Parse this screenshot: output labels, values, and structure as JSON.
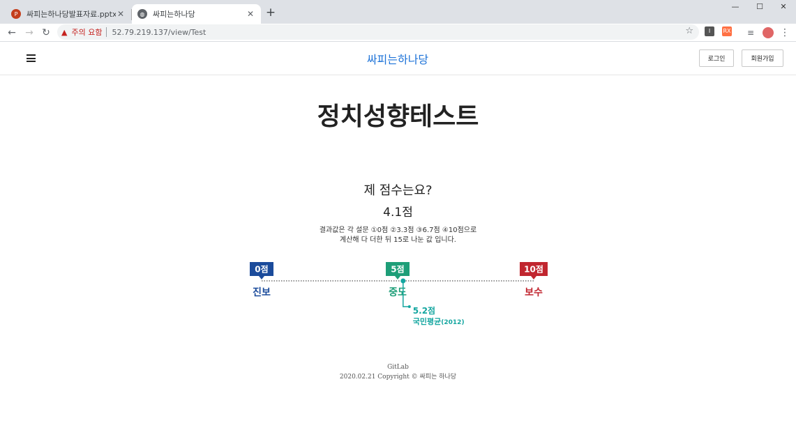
{
  "browser": {
    "tabs": [
      {
        "title": "싸피는하나당발표자료.pptx - Mi",
        "icon": "powerpoint-icon",
        "active": false
      },
      {
        "title": "싸피는하나당",
        "icon": "globe-icon",
        "active": true
      }
    ],
    "security_warning": "주의 요함",
    "url": "52.79.219.137/view/Test",
    "ext_1": "I",
    "ext_2": "RX"
  },
  "site": {
    "brand": "싸피는하나당",
    "login_label": "로그인",
    "signup_label": "회원가입"
  },
  "test": {
    "title": "정치성향테스트",
    "question": "제 점수는요?",
    "score": "4.1점",
    "explain_line1": "결과값은 각 설문 ①0점 ②3.3점 ③6.7점 ④10점으로",
    "explain_line2": "계산해 다 더한 뒤 15로 나눈 값 입니다."
  },
  "scale": {
    "markers": [
      {
        "badge": "0점",
        "label": "진보",
        "color": "#1b4b9b",
        "value": 0
      },
      {
        "badge": "5점",
        "label": "중도",
        "color": "#1e9e78",
        "value": 5
      },
      {
        "badge": "10점",
        "label": "보수",
        "color": "#c1262f",
        "value": 10
      }
    ],
    "average_value": 5.2,
    "average_score": "5.2점",
    "average_label": "국민평균",
    "average_year": "(2012)",
    "average_color": "#14a6a0"
  },
  "footer": {
    "line1": "GitLab",
    "line2": "2020.02.21 Copyright © 싸피는 하나당"
  }
}
